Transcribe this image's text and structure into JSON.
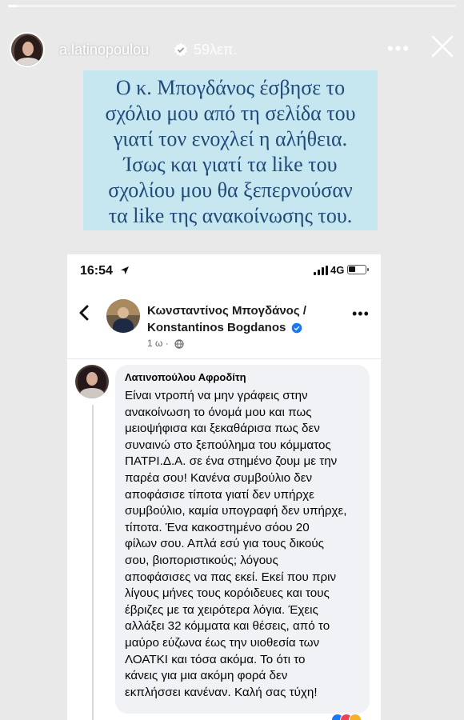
{
  "story": {
    "progress": 0.02,
    "username": "a.latinopoulou",
    "time_ago": "59λεπ."
  },
  "quote": {
    "text": "Ο κ. Μπογδάνος έσβησε το\nσχόλιο μου από τη σελίδα του\nγιατί τον ενοχλεί η αλήθεια.\nΊσως και γιατί τα like του\nσχολίου μου θα ξεπερνούσαν\nτα like της ανακοίνωσης του.",
    "background": "#c6e6f0",
    "color": "#1f4a7a"
  },
  "phone": {
    "status": {
      "time": "16:54",
      "network": "4G",
      "battery_level": 0.4
    },
    "page": {
      "name_line1": "Κωνσταντίνος Μπογδάνος /",
      "name_line2": "Konstantinos Bogdanos",
      "meta": "1 ω ·"
    },
    "comment": {
      "author": "Λατινοπούλου Αφροδίτη",
      "text": "Είναι ντροπή να μην γράφεις στην\nανακοίνωση το όνομά μου και πως\nμειοψήφισα και ξεκαθάρισα πως δεν\nσυναινώ στο ξεπούλημα του κόμματος\nΠΑΤΡΙ.Δ.Α. σε ένα στημένο ζουμ με την\nπαρέα σου! Κανένα συμβούλιο δεν\nαποφάσισε τίποτα γιατί δεν υπήρχε\nσυμβούλιο, καμία υπογραφή δεν υπήρχε,\nτίποτα. Ένα κακοστημένο σόου 20\nφίλων σου. Απλά εσύ για τους δικούς\nσου, βιοποριστικούς; λόγους\nαποφάσισες να πας εκεί. Εκεί που πριν\nλίγους μήνες τους κορόιδευες και τους\nέβριζες με τα χειρότερα λόγια. Έχεις\nαλλάξει 32 κόμματα και θέσεις, από το\nμαύρο εύζωνα έως την υιοθεσία των\nΛΟΑΤΚΙ και τόσα ακόμα.  Το ότι το\nκάνεις για μια ακόμη φορά δεν\nεκπλήσσει κανέναν. Καλή σας τύχη!"
    }
  },
  "colors": {
    "fb_blue": "#1877f2",
    "bubble": "#f0f2f5"
  },
  "icons": [
    "verified-badge-icon",
    "more-icon",
    "close-icon",
    "location-arrow-icon",
    "signal-icon",
    "battery-icon",
    "back-arrow-icon",
    "globe-icon",
    "reaction-icons"
  ]
}
